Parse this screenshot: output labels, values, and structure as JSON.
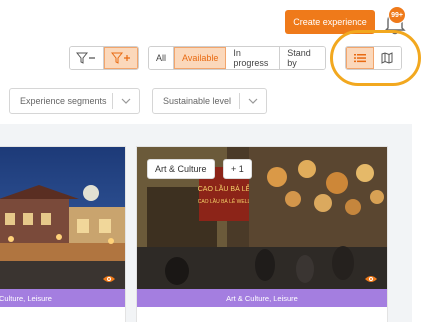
{
  "header": {
    "create_label": "Create experience",
    "notification_count": "99+"
  },
  "filters": {
    "funnel_minus": "−",
    "funnel_plus": "+",
    "status_tabs": [
      {
        "label": "All"
      },
      {
        "label": "Available"
      },
      {
        "label": "In progress"
      },
      {
        "label": "Stand by"
      }
    ],
    "active_status": "Available"
  },
  "dropdowns": {
    "segments_label": "Experience segments",
    "sustainable_label": "Sustainable level"
  },
  "cards": [
    {
      "caption": "Culture, Leisure"
    },
    {
      "tag_primary": "Art & Culture",
      "tag_more": "+ 1",
      "caption": "Art & Culture, Leisure",
      "sign_text_1": "CAO LẦU BÁ LỄ",
      "sign_text_2": "CAO LẦU BÁ LỄ WELL"
    }
  ],
  "colors": {
    "accent": "#ef7a1a",
    "active_bg": "#fbd8bb",
    "caption_bg": "#a47ee0",
    "highlight": "#f2a81f"
  }
}
